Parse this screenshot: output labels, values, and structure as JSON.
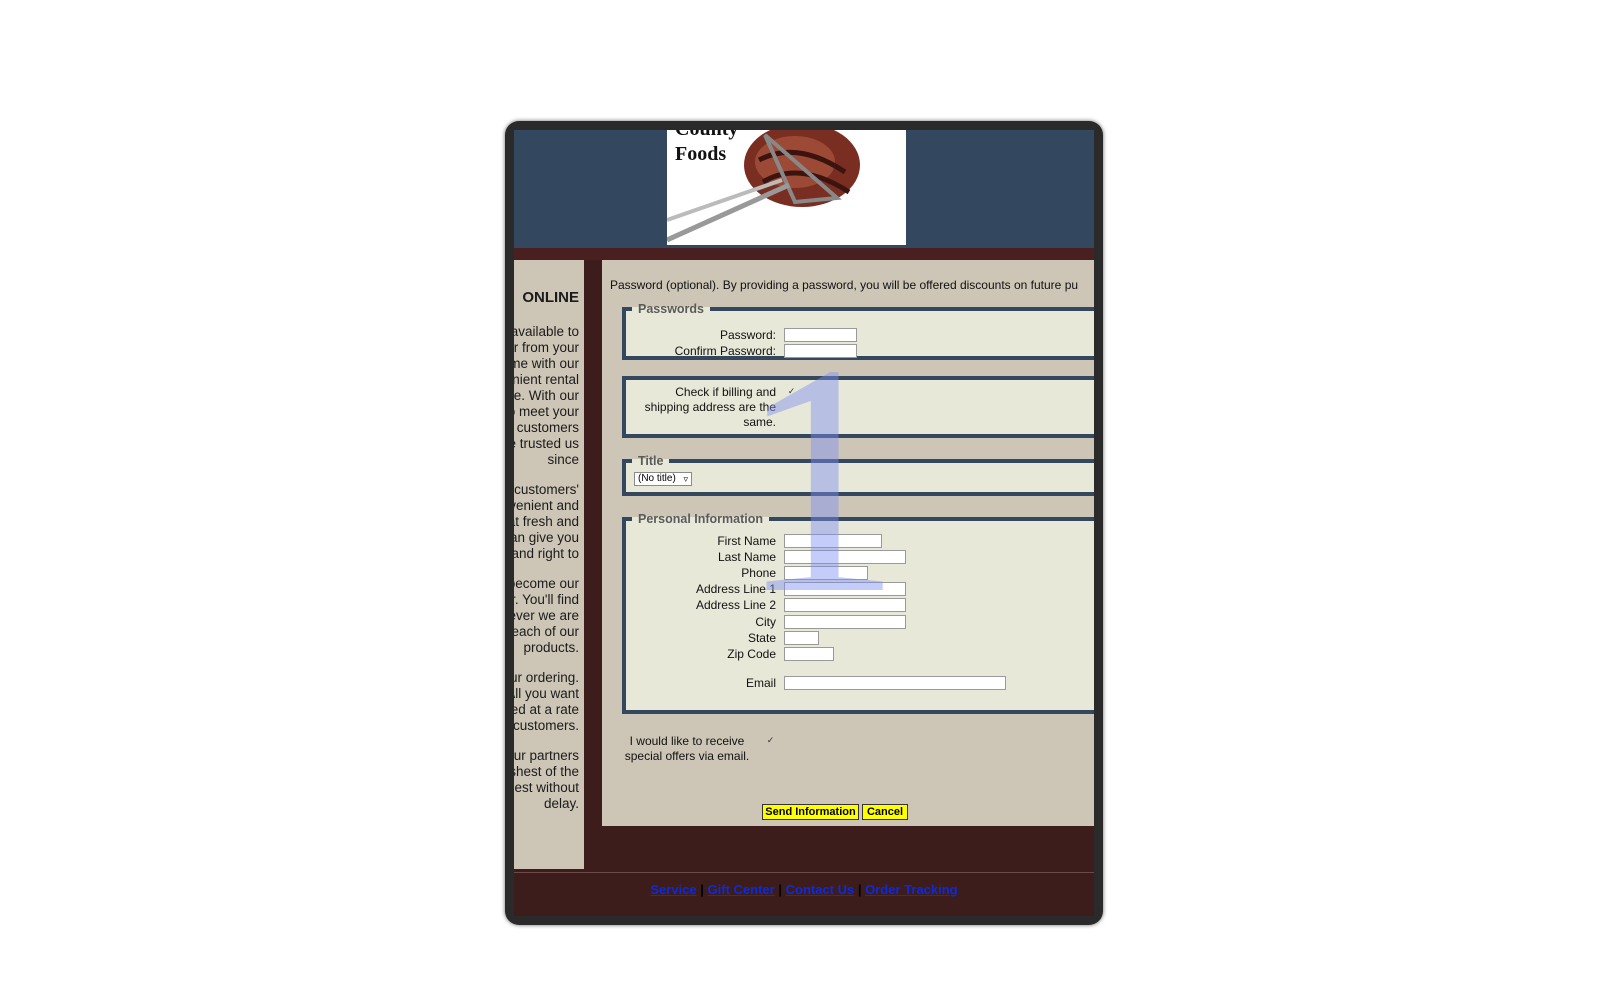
{
  "logo": {
    "name_top": "County",
    "name": "Foods"
  },
  "sidebar": {
    "heading": "ONLINE",
    "paragraphs": [
      "Now available to order from your home with our convenient rental service. With our best to meet your needs, customers have trusted us since",
      "Our customers' convenient and great fresh and flavor can give you and right to",
      "You can become our member. You'll find whatever we are serving each of our products.",
      "Start your ordering. All you want delivered at a rate our customers.",
      "Our partners freshest of the freshest without delay."
    ]
  },
  "form": {
    "intro": "Password (optional). By providing a password, you will be offered discounts on future pu",
    "passwords": {
      "legend": "Passwords",
      "password_label": "Password:",
      "confirm_label": "Confirm Password:"
    },
    "billing": {
      "label_line1": "Check if billing and",
      "label_line2": "shipping address are the",
      "label_line3": "same.",
      "checked": "✓"
    },
    "title": {
      "legend": "Title",
      "selected": "(No title)"
    },
    "personal": {
      "legend": "Personal Information",
      "first_name": "First Name",
      "last_name": "Last Name",
      "phone": "Phone",
      "address1": "Address Line 1",
      "address2": "Address Line 2",
      "city": "City",
      "state": "State",
      "zip": "Zip Code",
      "email": "Email"
    },
    "offers": {
      "line1": "I would like to receive",
      "line2": "special offers via email.",
      "checked": "✓"
    },
    "send_label": "Send Information",
    "cancel_label": "Cancel"
  },
  "footer": {
    "links": [
      "Service",
      "Gift Center",
      "Contact Us",
      "Order Tracking"
    ],
    "separator": "|"
  },
  "watermark": "1",
  "colors": {
    "header": "#33475f",
    "frame": "#3d1c1c",
    "panel": "#cdc6b7",
    "button": "#ffff00",
    "link": "#0a2be0"
  }
}
